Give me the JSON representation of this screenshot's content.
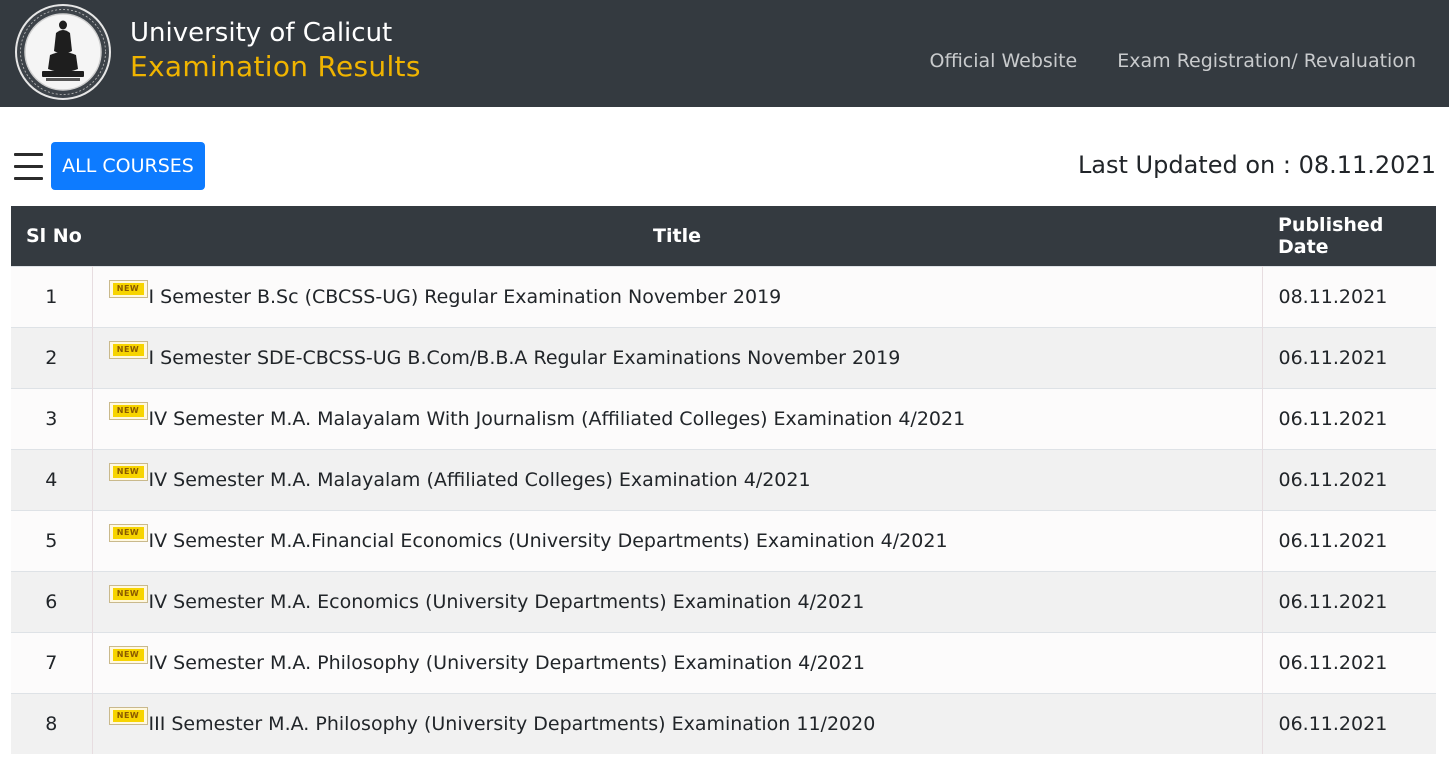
{
  "header": {
    "university_name": "University of Calicut",
    "site_title": "Examination Results",
    "logo_icon": "university-seal-icon",
    "nav_links": [
      {
        "label": "Official Website"
      },
      {
        "label": "Exam Registration/ Revaluation"
      }
    ],
    "colors": {
      "navbar_bg": "#343a40",
      "title_accent": "#f0b400",
      "button_primary": "#0d7bff"
    }
  },
  "toolbar": {
    "menu_icon": "hamburger-menu-icon",
    "all_courses_label": "ALL COURSES",
    "last_updated_label": "Last Updated on : 08.11.2021"
  },
  "table": {
    "headers": {
      "sl_no": "Sl No",
      "title": "Title",
      "published_date": "Published Date"
    },
    "badge_label": "NEW",
    "rows": [
      {
        "sl": "1",
        "title": "I Semester B.Sc (CBCSS-UG) Regular Examination November 2019",
        "date": "08.11.2021"
      },
      {
        "sl": "2",
        "title": "I Semester SDE-CBCSS-UG B.Com/B.B.A Regular Examinations November 2019",
        "date": "06.11.2021"
      },
      {
        "sl": "3",
        "title": "IV Semester M.A. Malayalam With Journalism (Affiliated Colleges) Examination 4/2021",
        "date": "06.11.2021"
      },
      {
        "sl": "4",
        "title": "IV Semester M.A. Malayalam (Affiliated Colleges) Examination 4/2021",
        "date": "06.11.2021"
      },
      {
        "sl": "5",
        "title": "IV Semester M.A.Financial Economics (University Departments) Examination 4/2021",
        "date": "06.11.2021"
      },
      {
        "sl": "6",
        "title": "IV Semester M.A. Economics (University Departments) Examination 4/2021",
        "date": "06.11.2021"
      },
      {
        "sl": "7",
        "title": "IV Semester M.A. Philosophy (University Departments) Examination 4/2021",
        "date": "06.11.2021"
      },
      {
        "sl": "8",
        "title": "III Semester M.A. Philosophy (University Departments) Examination 11/2020",
        "date": "06.11.2021"
      }
    ]
  }
}
